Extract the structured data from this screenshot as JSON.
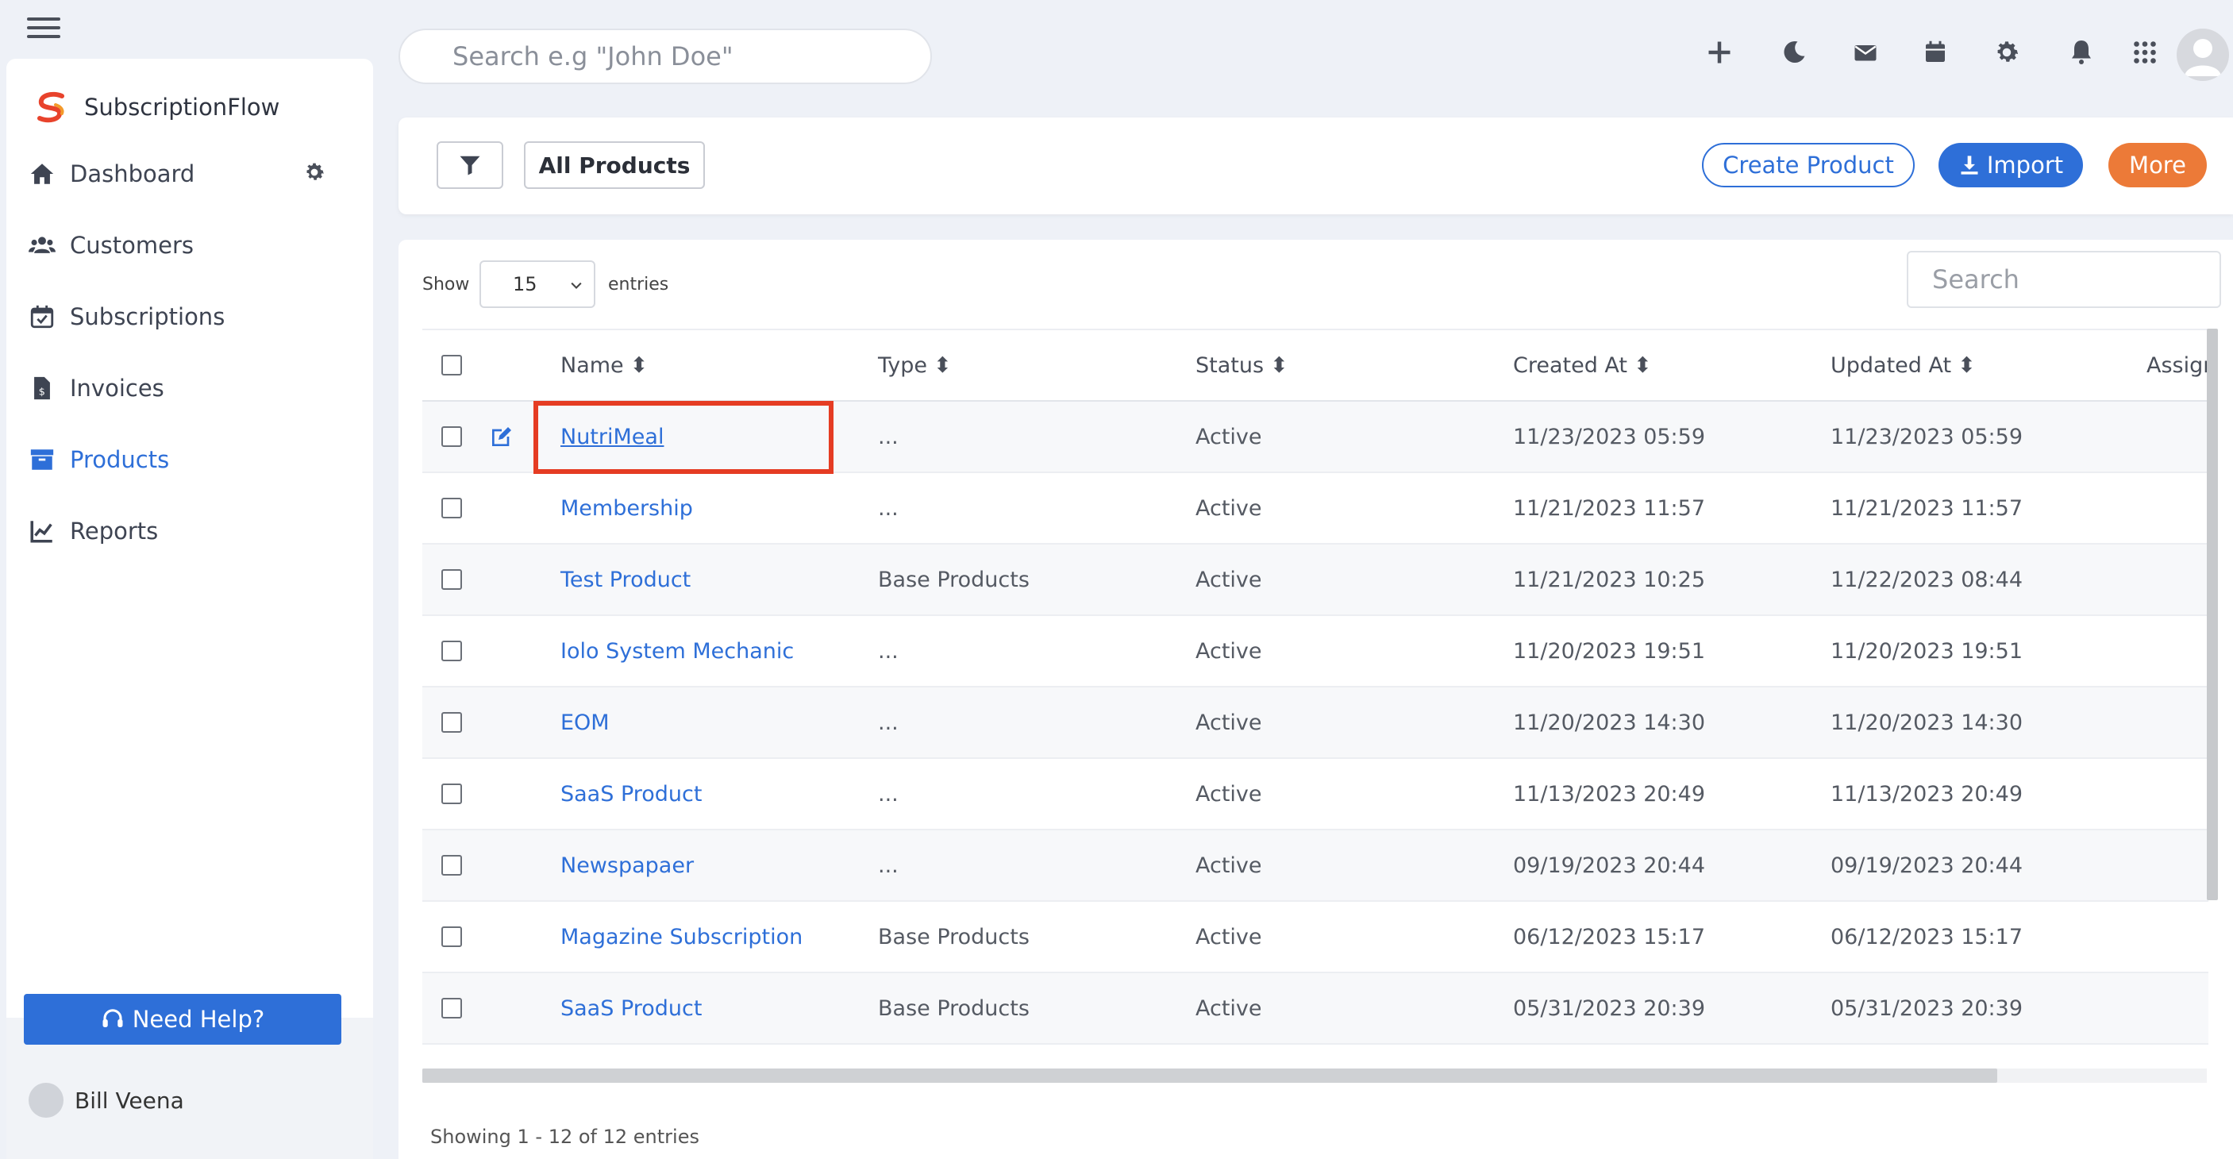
{
  "app": {
    "brand_name": "SubscriptionFlow"
  },
  "topbar": {
    "search_placeholder": "Search e.g \"John Doe\"",
    "icons": [
      "plus-icon",
      "moon-icon",
      "mail-icon",
      "calendar-icon",
      "gear-icon",
      "bell-icon",
      "apps-grid-icon",
      "avatar"
    ]
  },
  "sidebar": {
    "items": [
      {
        "label": "Dashboard",
        "icon": "home-icon"
      },
      {
        "label": "Customers",
        "icon": "users-icon"
      },
      {
        "label": "Subscriptions",
        "icon": "calendar-check-icon"
      },
      {
        "label": "Invoices",
        "icon": "invoice-icon"
      },
      {
        "label": "Products",
        "icon": "archive-box-icon",
        "active": true
      },
      {
        "label": "Reports",
        "icon": "chart-line-icon"
      }
    ],
    "help_label": "Need Help?",
    "user_name": "Bill Veena"
  },
  "toolbar": {
    "view_label": "All Products",
    "create_label": "Create Product",
    "import_label": "Import",
    "more_label": "More"
  },
  "table": {
    "show_label": "Show",
    "entries_value": "15",
    "entries_label": "entries",
    "search_placeholder": "Search",
    "columns": [
      "Name",
      "Type",
      "Status",
      "Created At",
      "Updated At",
      "Assign"
    ],
    "rows": [
      {
        "name": "NutriMeal",
        "type": "...",
        "status": "Active",
        "created": "11/23/2023 05:59",
        "updated": "11/23/2023 05:59"
      },
      {
        "name": "Membership",
        "type": "...",
        "status": "Active",
        "created": "11/21/2023 11:57",
        "updated": "11/21/2023 11:57"
      },
      {
        "name": "Test Product",
        "type": "Base Products",
        "status": "Active",
        "created": "11/21/2023 10:25",
        "updated": "11/22/2023 08:44"
      },
      {
        "name": "Iolo System Mechanic",
        "type": "...",
        "status": "Active",
        "created": "11/20/2023 19:51",
        "updated": "11/20/2023 19:51"
      },
      {
        "name": "EOM",
        "type": "...",
        "status": "Active",
        "created": "11/20/2023 14:30",
        "updated": "11/20/2023 14:30"
      },
      {
        "name": "SaaS Product",
        "type": "...",
        "status": "Active",
        "created": "11/13/2023 20:49",
        "updated": "11/13/2023 20:49"
      },
      {
        "name": "Newspapaer",
        "type": "...",
        "status": "Active",
        "created": "09/19/2023 20:44",
        "updated": "09/19/2023 20:44"
      },
      {
        "name": "Magazine Subscription",
        "type": "Base Products",
        "status": "Active",
        "created": "06/12/2023 15:17",
        "updated": "06/12/2023 15:17"
      },
      {
        "name": "SaaS Product",
        "type": "Base Products",
        "status": "Active",
        "created": "05/31/2023 20:39",
        "updated": "05/31/2023 20:39"
      }
    ],
    "footer_text": "Showing 1 - 12 of 12 entries"
  },
  "colors": {
    "accent": "#2e6fd8",
    "more": "#ec7a38",
    "highlight": "#e53c23",
    "brand_red": "#e8432c",
    "brand_orange": "#f39a2b"
  }
}
